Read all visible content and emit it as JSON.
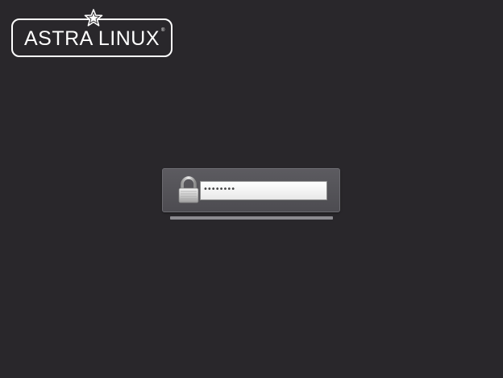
{
  "logo": {
    "text": "ASTRA LINUX",
    "registered_mark": "®",
    "star_icon": "star-icon"
  },
  "login": {
    "lock_icon": "lock-icon",
    "password_value": "••••••••",
    "password_length": 8
  },
  "progress": {
    "fraction": 1.0
  },
  "colors": {
    "background": "#29272b",
    "panel": "#55545a",
    "logo": "#ffffff"
  }
}
